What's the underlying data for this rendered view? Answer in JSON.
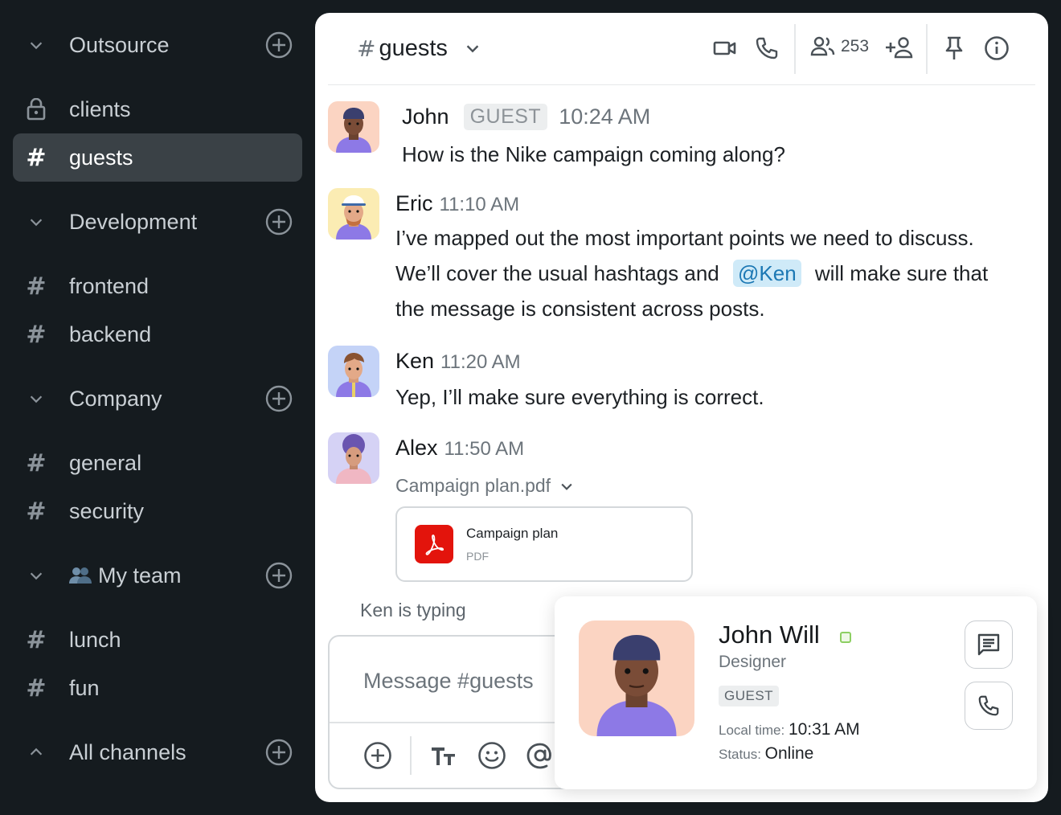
{
  "sidebar": {
    "groups": [
      {
        "name": "Outsource",
        "expanded": true
      },
      {
        "name": "Development",
        "expanded": true
      },
      {
        "name": "Company",
        "expanded": true
      },
      {
        "name": "My team",
        "expanded": true,
        "emoji": "👥"
      },
      {
        "name": "All channels",
        "expanded": false
      }
    ],
    "channels": {
      "clients": "clients",
      "guests": "guests",
      "frontend": "frontend",
      "backend": "backend",
      "general": "general",
      "security": "security",
      "lunch": "lunch",
      "fun": "fun"
    },
    "active_channel": "guests",
    "colors": {
      "background": "#151b1f",
      "active": "#3a4146"
    }
  },
  "header": {
    "hash": "#",
    "channel": "guests",
    "member_count": "253",
    "icons": [
      "video-icon",
      "phone-icon",
      "members-icon",
      "add-member-icon",
      "pin-icon",
      "info-icon"
    ]
  },
  "messages": [
    {
      "author": "John",
      "tag": "GUEST",
      "time": "10:24 AM",
      "text": "How is the Nike campaign coming along?"
    },
    {
      "author": "Eric",
      "time": "11:10 AM",
      "line1": "I’ve mapped out the most important points we need to discuss.",
      "line2_before": "We’ll cover the usual hashtags and",
      "mention": "@Ken",
      "line2_after": "will make sure that",
      "line3": "the message is consistent across posts."
    },
    {
      "author": "Ken",
      "time": "11:20 AM",
      "text": "Yep, I’ll make sure everything is correct."
    },
    {
      "author": "Alex",
      "time": "11:50 AM",
      "file_label": "Campaign plan.pdf",
      "file": {
        "name": "Campaign plan",
        "type": "PDF"
      }
    }
  ],
  "typing_indicator": "Ken is typing",
  "composer": {
    "placeholder": "Message #guests"
  },
  "profile_card": {
    "name": "John Will",
    "role": "Designer",
    "tag": "GUEST",
    "local_time_label": "Local time:",
    "local_time": "10:31 AM",
    "status_label": "Status:",
    "status": "Online"
  },
  "colors": {
    "mention_bg": "#cfeaf8",
    "mention_text": "#1c78b4",
    "pdf": "#e3140c",
    "online": "#8dcf63"
  }
}
